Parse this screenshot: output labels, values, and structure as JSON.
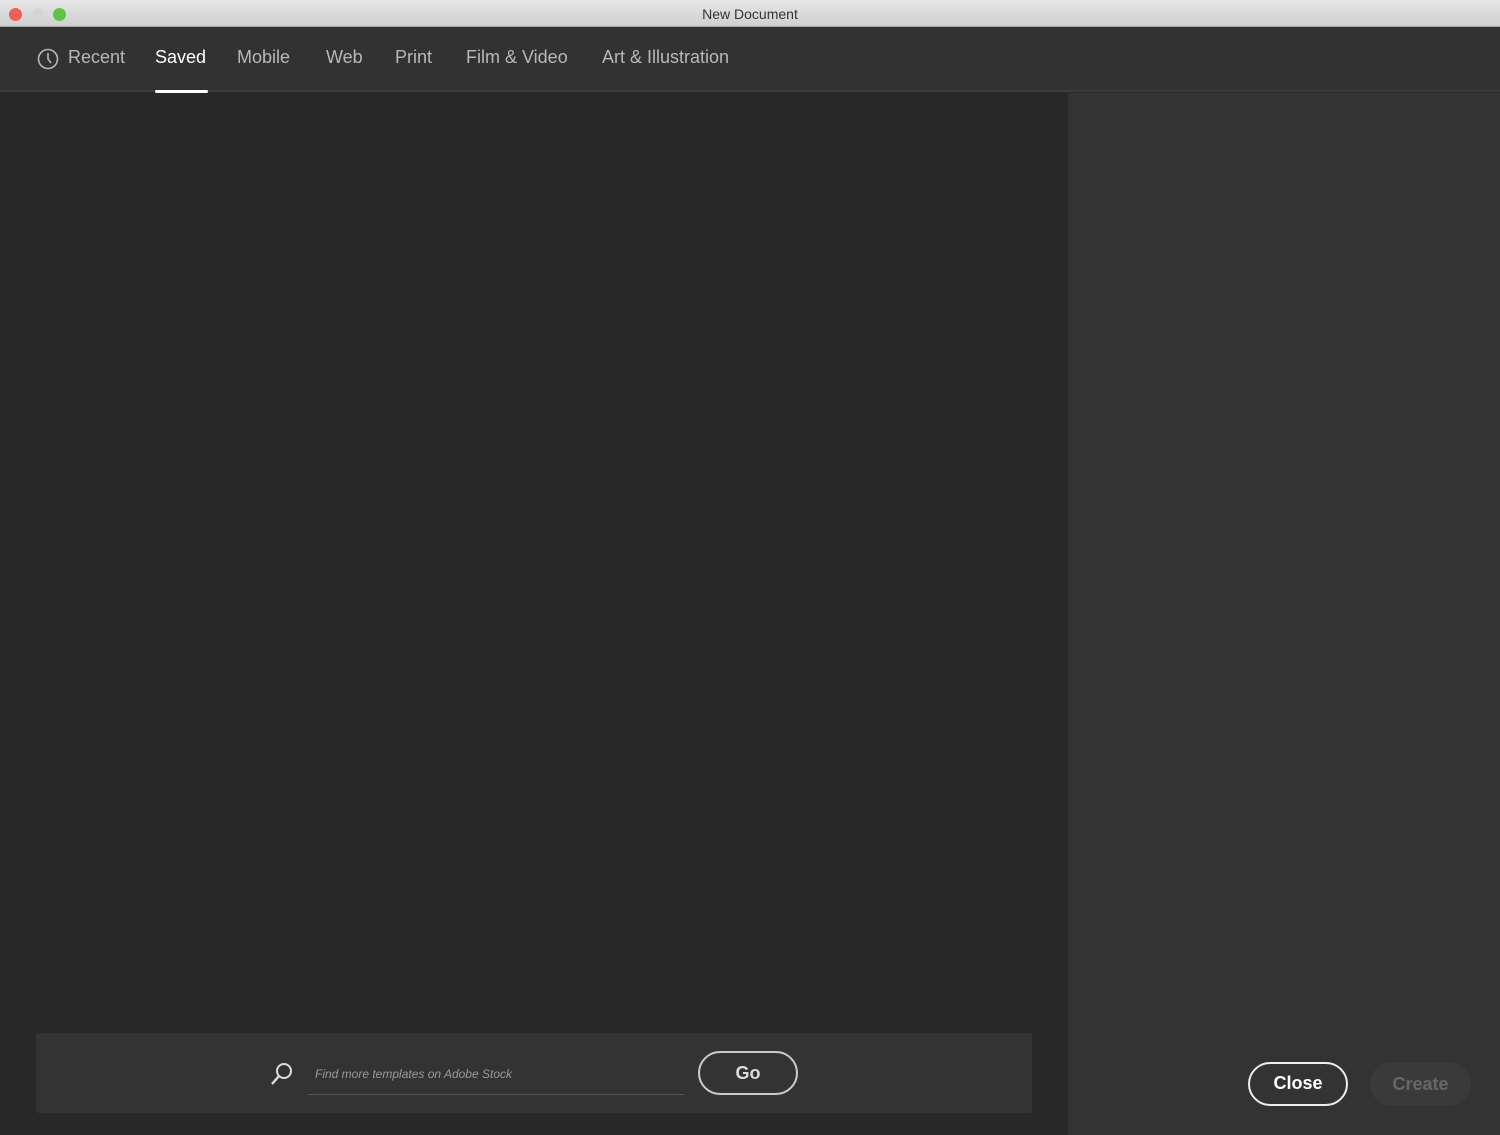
{
  "window": {
    "title": "New Document"
  },
  "tabs": [
    {
      "label": "Recent"
    },
    {
      "label": "Saved"
    },
    {
      "label": "Mobile"
    },
    {
      "label": "Web"
    },
    {
      "label": "Print"
    },
    {
      "label": "Film & Video"
    },
    {
      "label": "Art & Illustration"
    }
  ],
  "search": {
    "placeholder": "Find more templates on Adobe Stock",
    "go_label": "Go"
  },
  "actions": {
    "close_label": "Close",
    "create_label": "Create"
  }
}
